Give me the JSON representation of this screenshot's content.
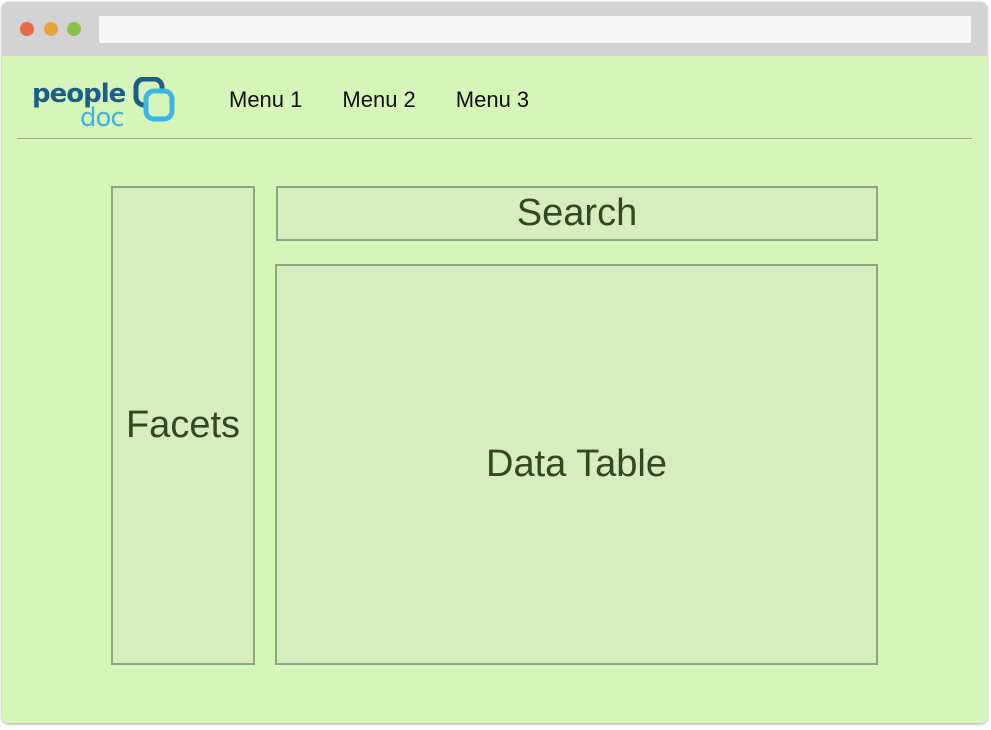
{
  "window": {
    "controls": [
      "close",
      "minimize",
      "maximize"
    ],
    "address": ""
  },
  "logo": {
    "line1": "people",
    "line2": "doc",
    "icon": "peopledoc-logo-icon",
    "colors": {
      "primary": "#1b5e8a",
      "secondary": "#3cb4e6"
    }
  },
  "nav": {
    "items": [
      {
        "label": "Menu 1"
      },
      {
        "label": "Menu 2"
      },
      {
        "label": "Menu 3"
      }
    ]
  },
  "main": {
    "facets_label": "Facets",
    "search_label": "Search",
    "table_label": "Data Table"
  },
  "colors": {
    "background": "#d6f5b8",
    "panel": "#d5edc0",
    "panel_border": "#8aa683",
    "text": "#2e4a22"
  }
}
